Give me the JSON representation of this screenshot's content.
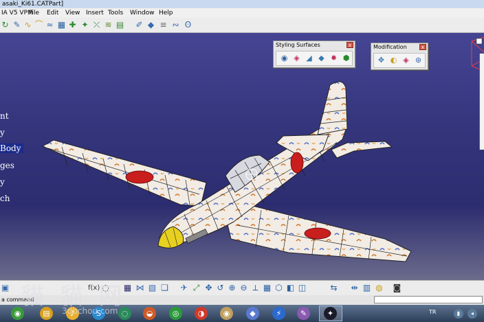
{
  "window": {
    "title": "asaki_Ki61.CATPart]"
  },
  "menu": {
    "items": [
      "IA V5 VPM",
      "File",
      "Edit",
      "View",
      "Insert",
      "Tools",
      "Window",
      "Help"
    ]
  },
  "tree": {
    "labels": [
      "nt",
      "y",
      "Body",
      "ges",
      "y",
      "ch"
    ]
  },
  "styling_panel": {
    "title": "Styling Surfaces",
    "close": "x"
  },
  "modification_panel": {
    "title": "Modification",
    "close": "x"
  },
  "status": {
    "text": "a command"
  },
  "taskbar": {
    "lang": "TR"
  },
  "watermark": {
    "chars": "貓 貓 网",
    "url": "3dbchou.com"
  },
  "colors": {
    "viewport": "#3a3a84",
    "roundel": "#c81e1e",
    "spinner": "#e8d020",
    "fuselage": "#f2ece4"
  }
}
